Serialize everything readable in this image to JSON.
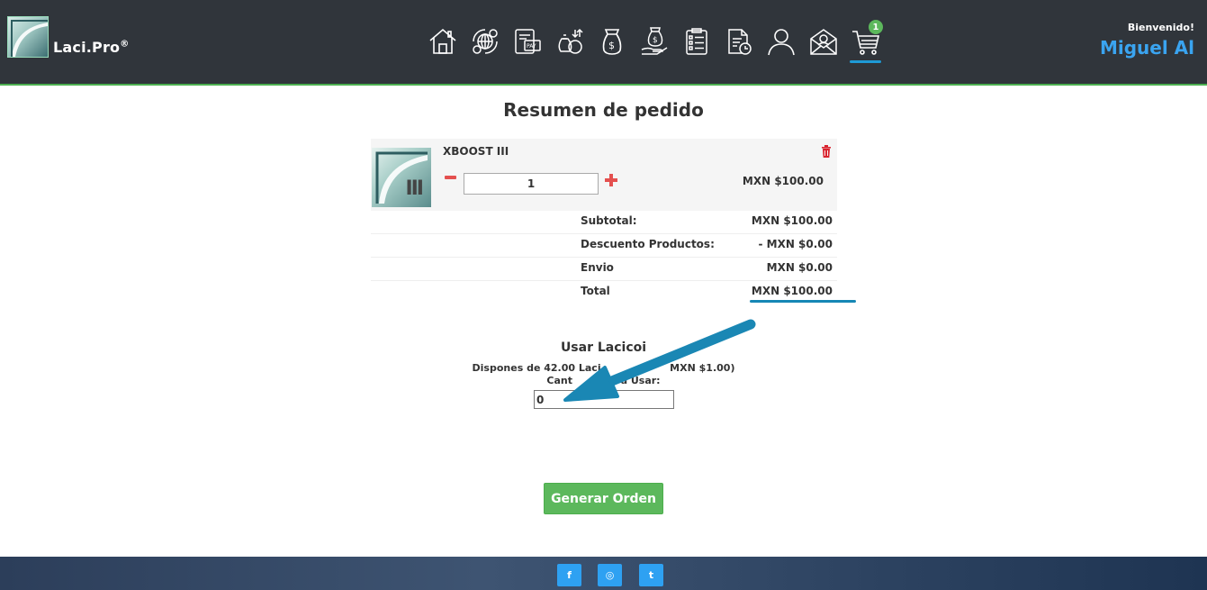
{
  "header": {
    "brand_name": "Laci.Pro",
    "brand_mark": "®",
    "welcome_label": "Bienvenido!",
    "user_name": "Miguel Al",
    "cart_count": "1",
    "accent_color": "#1e9ad6",
    "nav_icons": [
      "home-icon",
      "globe-exchange-icon",
      "pay-card-icon",
      "money-transfer-icon",
      "money-bag-icon",
      "money-hand-icon",
      "checklist-icon",
      "report-clock-icon",
      "user-icon",
      "mail-icon",
      "cart-icon"
    ]
  },
  "page": {
    "title": "Resumen de pedido"
  },
  "cart_item": {
    "name": "XBOOST III",
    "thumb_text": "III",
    "quantity": "1",
    "price": "MXN $100.00"
  },
  "summary": {
    "rows": [
      {
        "label": "Subtotal:",
        "value": "MXN $100.00"
      },
      {
        "label": "Descuento Productos:",
        "value": "- MXN $0.00"
      },
      {
        "label": "Envio",
        "value": "MXN $0.00"
      },
      {
        "label": "Total",
        "value": "MXN $100.00"
      }
    ]
  },
  "lacicoin": {
    "title": "Usar Lacicoi",
    "info": "Dispones de 42.00 Laci                    MXN $1.00)",
    "quantity_label": "Cant              a Usar:",
    "value": "0"
  },
  "actions": {
    "generate_order": "Generar Orden"
  },
  "footer": {
    "facebook": "f",
    "instagram": "◎",
    "twitter": "t"
  }
}
